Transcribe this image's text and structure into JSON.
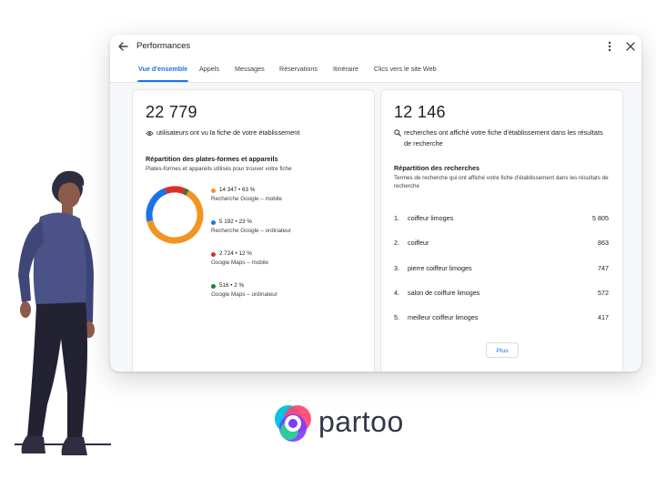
{
  "window": {
    "title": "Performances",
    "tabs": [
      {
        "label": "Vue d'ensemble",
        "active": true
      },
      {
        "label": "Appels",
        "active": false
      },
      {
        "label": "Messages",
        "active": false
      },
      {
        "label": "Réservations",
        "active": false
      },
      {
        "label": "Itinéraire",
        "active": false
      },
      {
        "label": "Clics vers le site Web",
        "active": false
      }
    ],
    "icons": [
      "back-arrow-icon",
      "more-vert-icon",
      "close-icon"
    ],
    "accent_color": "#1a73e8"
  },
  "users_card": {
    "value": "22 779",
    "caption": "utilisateurs ont vu la fiche de votre établissement",
    "caption_icon": "eye-icon",
    "section_title": "Répartition des plates-formes et appareils",
    "section_subtitle": "Plates-formes et appareils utilisés pour trouver votre fiche",
    "breakdown": [
      {
        "value": "14 347 • 63 %",
        "label": "Recherche Google – mobile",
        "color": "#f29422",
        "percent": 63
      },
      {
        "value": "5 192 • 23 %",
        "label": "Recherche Google – ordinateur",
        "color": "#1a73e8",
        "percent": 23
      },
      {
        "value": "2 724 • 12 %",
        "label": "Google Maps – mobile",
        "color": "#d93025",
        "percent": 12
      },
      {
        "value": "516 • 2 %",
        "label": "Google Maps – ordinateur",
        "color": "#188038",
        "percent": 2
      }
    ]
  },
  "search_card": {
    "value": "12 146",
    "caption": "recherches ont affiché votre fiche d'établissement dans les résultats de recherche",
    "caption_icon": "search-icon",
    "section_title": "Répartition des recherches",
    "section_subtitle": "Termes de recherche qui ont affiché votre fiche d'établissement dans les résultats de recherche",
    "rows": [
      {
        "rank": "1.",
        "term": "coiffeur limoges",
        "count": "5 805"
      },
      {
        "rank": "2.",
        "term": "coiffeur",
        "count": "863"
      },
      {
        "rank": "3.",
        "term": "pierre coiffeur limoges",
        "count": "747"
      },
      {
        "rank": "4.",
        "term": "salon de coiffure limoges",
        "count": "572"
      },
      {
        "rank": "5.",
        "term": "meilleur coiffeur limoges",
        "count": "417"
      }
    ],
    "more_button": "Plus"
  },
  "brand": {
    "logo_text": "partoo",
    "text_color": "#333848"
  }
}
